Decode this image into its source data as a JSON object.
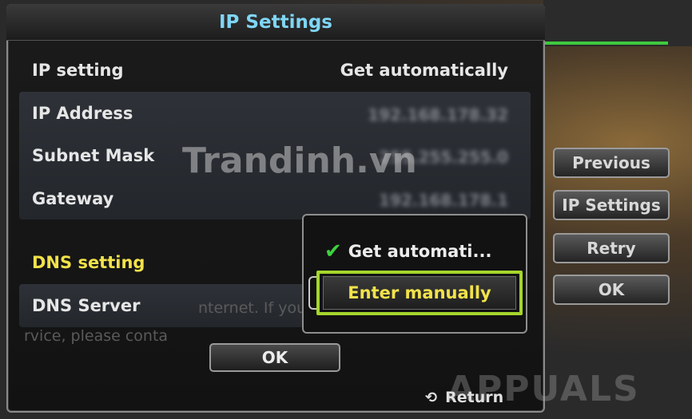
{
  "dialog": {
    "title": "IP Settings",
    "ip_setting": {
      "label": "IP setting",
      "value": "Get automatically"
    },
    "ip_fields": [
      {
        "label": "IP Address",
        "value": "192.168.178.32"
      },
      {
        "label": "Subnet Mask",
        "value": "255.255.255.0"
      },
      {
        "label": "Gateway",
        "value": "192.168.178.1"
      }
    ],
    "dns_setting": {
      "label": "DNS setting"
    },
    "dns_server": {
      "label": "DNS Server"
    },
    "background_text": {
      "line1": "nternet. If you h",
      "line2": "rvice, please conta"
    },
    "ok_label": "OK",
    "return_label": "Return"
  },
  "dns_popup": {
    "options": [
      {
        "label": "Get automati...",
        "checked": true
      },
      {
        "label": "Enter manually",
        "highlighted": true
      }
    ]
  },
  "side_buttons": [
    "Previous",
    "IP Settings",
    "Retry",
    "OK"
  ],
  "watermarks": {
    "site": "Trandinh.vn",
    "logo": "APPUALS"
  },
  "colors": {
    "title": "#7fd6f5",
    "dns_label": "#f2e24a",
    "highlight_border": "#a5d62b",
    "check": "#3ed13e",
    "status_line": "#3ec93e"
  }
}
